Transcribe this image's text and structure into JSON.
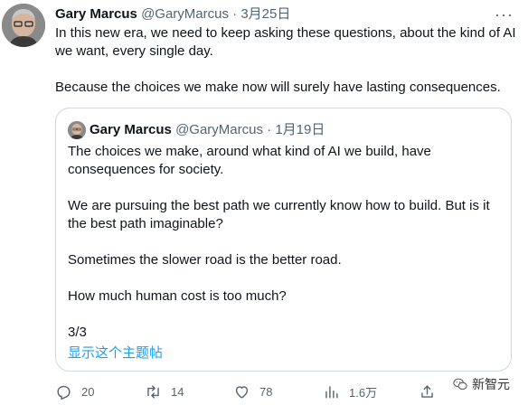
{
  "tweet": {
    "author_name": "Gary Marcus",
    "handle": "@GaryMarcus",
    "separator": "·",
    "date": "3月25日",
    "more_label": "···",
    "paragraphs": [
      "In this new era, we need to keep asking these questions, about the kind of AI we want, every single day.",
      "Because the choices we make now will surely have lasting consequences."
    ]
  },
  "quoted_tweet": {
    "author_name": "Gary Marcus",
    "handle": "@GaryMarcus",
    "separator": "·",
    "date": "1月19日",
    "paragraphs": [
      "The choices we make, around what kind of AI we build, have consequences for society.",
      "We are pursuing the best path we currently know how to build. But is it the best path imaginable?",
      "Sometimes the slower road is the better road.",
      "How much human cost is too much?",
      "3/3"
    ],
    "show_thread": "显示这个主题帖"
  },
  "actions": {
    "reply": {
      "icon": "reply-icon",
      "count": "20"
    },
    "retweet": {
      "icon": "retweet-icon",
      "count": "14"
    },
    "like": {
      "icon": "heart-icon",
      "count": "78"
    },
    "views": {
      "icon": "views-icon",
      "count": "1.6万"
    },
    "share": {
      "icon": "share-icon"
    }
  },
  "watermark": {
    "text": "新智元"
  },
  "colors": {
    "link": "#1d9bf0",
    "muted": "#536471",
    "border": "#cfd9de"
  }
}
